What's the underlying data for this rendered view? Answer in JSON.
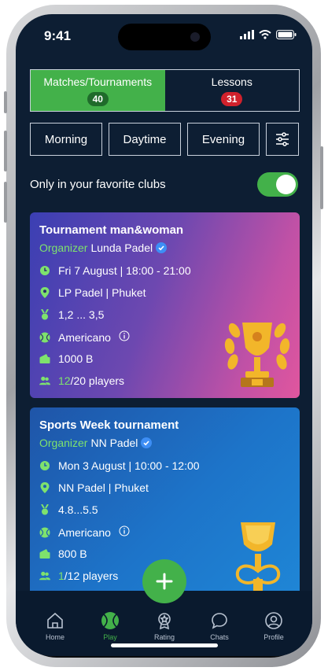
{
  "status": {
    "time": "9:41"
  },
  "tabs": [
    {
      "label": "Matches/Tournaments",
      "count": "40"
    },
    {
      "label": "Lessons",
      "count": "31"
    }
  ],
  "filters": [
    "Morning",
    "Daytime",
    "Evening"
  ],
  "favorites_toggle": {
    "label": "Only in your favorite clubs",
    "on": true
  },
  "cards": [
    {
      "title": "Tournament man&woman",
      "organizer_label": "Organizer",
      "organizer": "Lunda Padel",
      "date": "Fri 7 August |  18:00 - 21:00",
      "location": "LP Padel | Phuket",
      "level": "1,2 ... 3,5",
      "format": "Americano",
      "price": "1000 B",
      "players_current": "12",
      "players_rest": "/20 players"
    },
    {
      "title": "Sports Week tournament",
      "organizer_label": "Organizer",
      "organizer": "NN Padel",
      "date": "Mon 3 August | 10:00 - 12:00",
      "location": "NN Padel | Phuket",
      "level": "4.8...5.5",
      "format": "Americano",
      "price": "800 B",
      "players_current": "1",
      "players_rest": "/12 players"
    }
  ],
  "nav": [
    {
      "label": "Home",
      "icon": "home-icon"
    },
    {
      "label": "Play",
      "icon": "tennis-ball-icon"
    },
    {
      "label": "Rating",
      "icon": "medal-icon"
    },
    {
      "label": "Chats",
      "icon": "chat-icon"
    },
    {
      "label": "Profile",
      "icon": "profile-icon"
    }
  ],
  "colors": {
    "accent": "#43b14a",
    "background": "#0d1e33",
    "badge_red": "#d0212c"
  }
}
